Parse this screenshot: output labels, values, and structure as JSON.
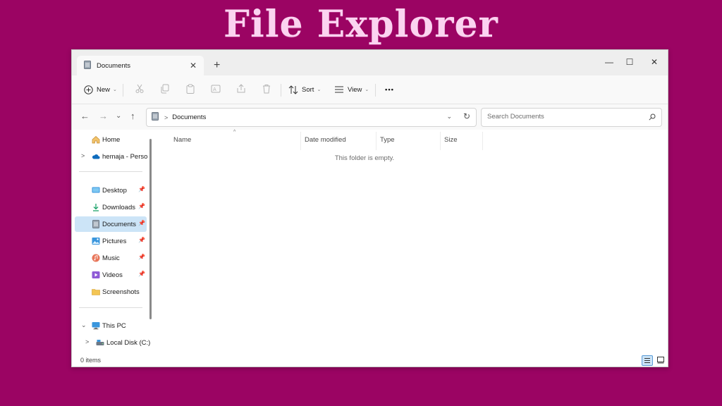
{
  "banner": {
    "title": "File Explorer"
  },
  "window": {
    "tab": {
      "label": "Documents",
      "close": "✕"
    },
    "new_tab": "+",
    "controls": {
      "minimize": "—",
      "maximize": "☐",
      "close": "✕"
    }
  },
  "toolbar": {
    "new_label": "New",
    "sort_label": "Sort",
    "view_label": "View",
    "more_label": "•••",
    "chevron": "⌄"
  },
  "nav": {
    "back": "←",
    "forward": "→",
    "recent": "⌄",
    "up": "↑",
    "address": {
      "separator": ">",
      "path": "Documents",
      "dropdown": "⌄",
      "refresh": "↻"
    },
    "search": {
      "placeholder": "Search Documents"
    }
  },
  "sidebar": {
    "home": {
      "label": "Home",
      "icon": "home-icon"
    },
    "onedrive": {
      "label": "hemaja - Personal",
      "icon": "cloud-icon",
      "expander": ">"
    },
    "quick_access": [
      {
        "label": "Desktop",
        "icon": "desktop-icon",
        "pinned": true
      },
      {
        "label": "Downloads",
        "icon": "download-icon",
        "pinned": true
      },
      {
        "label": "Documents",
        "icon": "document-icon",
        "pinned": true,
        "selected": true
      },
      {
        "label": "Pictures",
        "icon": "picture-icon",
        "pinned": true
      },
      {
        "label": "Music",
        "icon": "music-icon",
        "pinned": true
      },
      {
        "label": "Videos",
        "icon": "video-icon",
        "pinned": true
      },
      {
        "label": "Screenshots",
        "icon": "folder-icon",
        "pinned": false
      }
    ],
    "this_pc": {
      "label": "This PC",
      "icon": "computer-icon",
      "expander": "⌄"
    },
    "local_disk": {
      "label": "Local Disk (C:)",
      "icon": "disk-icon",
      "expander": ">"
    },
    "pin_glyph": "📌"
  },
  "content": {
    "columns": [
      "Name",
      "Date modified",
      "Type",
      "Size"
    ],
    "sort_indicator": "^",
    "empty_message": "This folder is empty."
  },
  "status": {
    "items": "0 items"
  },
  "colors": {
    "background": "#9b0463",
    "banner_text": "#fbd3f0",
    "selected": "#cce4f7",
    "accent": "#0067c0"
  }
}
